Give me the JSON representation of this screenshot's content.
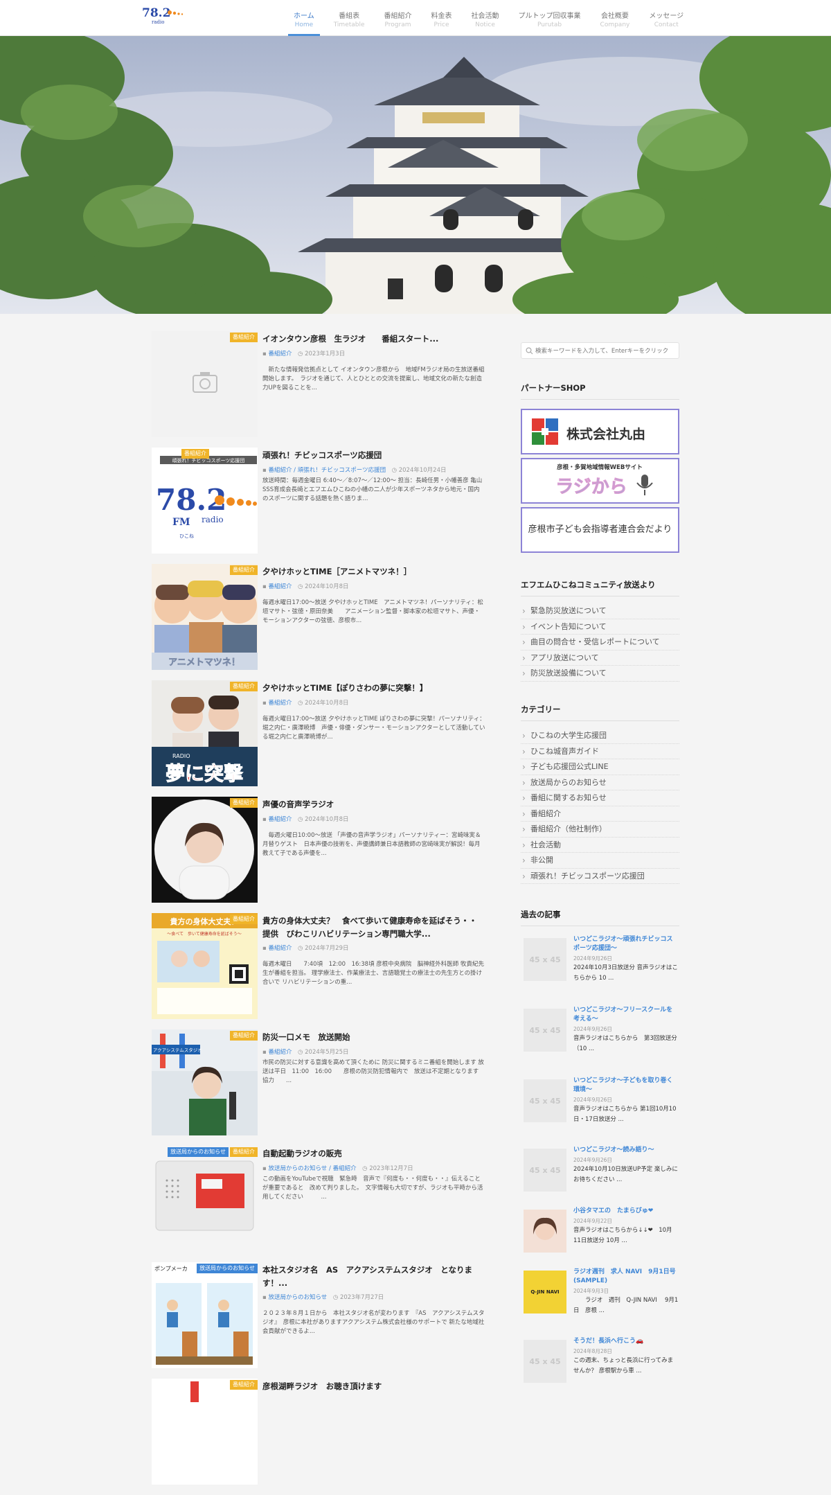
{
  "nav": [
    {
      "jp": "ホーム",
      "en": "Home"
    },
    {
      "jp": "番組表",
      "en": "Timetable"
    },
    {
      "jp": "番組紹介",
      "en": "Program"
    },
    {
      "jp": "料金表",
      "en": "Price"
    },
    {
      "jp": "社会活動",
      "en": "Notice"
    },
    {
      "jp": "プルトップ回収事業",
      "en": "Purutab"
    },
    {
      "jp": "会社概要",
      "en": "Company"
    },
    {
      "jp": "メッセージ",
      "en": "Contact"
    }
  ],
  "logo": {
    "number": "78.2",
    "sub": "radio"
  },
  "posts": [
    {
      "tag": "番組紹介",
      "title": "イオンタウン彦根　生ラジオ　　番組スタート...",
      "cats": "番組紹介",
      "date": "2023年1月3日",
      "excerpt": "　新たな情報発信拠点として イオンタウン彦根から　地域FMラジオ局の生放送番組 開始します。　ラジオを通じて、人とひととの交流を提案し、地域文化の新たな創造力UPを図ることを..."
    },
    {
      "tag": "番組紹介",
      "title": "頑張れ！チビッコスポーツ応援団",
      "cats": "番組紹介 / 頑張れ！チビッコスポーツ応援団",
      "date": "2024年10月24日",
      "excerpt": "放送時間：毎週金曜日 6:40〜／8:07〜／12:00〜 担当：長崎任男・小幡善彦 亀山SSS育成会長崎とエフエムひこねの小幡の二人が少年スポーツネタから地元・国内のスポーツに関する話題を熱く語りま..."
    },
    {
      "tag": "番組紹介",
      "title": "夕やけホッとTIME［アニメトマツネ！］",
      "cats": "番組紹介",
      "date": "2024年10月8日",
      "excerpt": "毎週水曜日17:00〜放送 夕やけホッとTIME　アニメトマツネ！パーソナリティ：松垣マサト・弦徳・原田奈美　　アニメーション監督・脚本家の松垣マサト、声優・モーションアクターの弦徳、彦根市..."
    },
    {
      "tag": "番組紹介",
      "title": "夕やけホッとTIME【ぽりさわの夢に突撃！】",
      "cats": "番組紹介",
      "date": "2024年10月8日",
      "excerpt": "毎週火曜日17:00〜放送 夕やけホッとTIME ぽりさわの夢に突撃！パーソナリティ：堀之内仁・廣澤暁博　声優・俳優・ダンサー・モーションアクターとして活動している堀之内仁と廣澤暁博が..."
    },
    {
      "tag": "番組紹介",
      "title": "声優の音声学ラジオ",
      "cats": "番組紹介",
      "date": "2024年10月8日",
      "excerpt": "　毎週火曜日10:00〜放送 「声優の音声学ラジオ」パーソナリティー：宮崎味実＆月替りゲスト　日本声優の技術を、声優講師兼日本語教師の宮崎味実が解説！毎月教えて子である声優を..."
    },
    {
      "tag": "番組紹介",
      "title": "貴方の身体大丈夫？　食べて歩いて健康寿命を延ばそう・・ 提供　びわこリハビリテーション専門職大学...",
      "cats": "番組紹介",
      "date": "2024年7月29日",
      "excerpt": "毎週木曜日　　7:40頃　12:00　16:38頃 彦根中央病院　脳神経外科医師 牧責紀先生が番組を担当。 理学療法士、作業療法士、言語聴覚士の療法士の先生方との掛け合いで リハビリテーションの重..."
    },
    {
      "tag": "番組紹介",
      "title": "防災一口メモ　放送開始",
      "cats": "番組紹介",
      "date": "2024年5月25日",
      "excerpt": "市民の防災に対する意識を高めて頂くために 防災に関するミニ番組を開始します 放送は平日　11:00　16:00　　彦根の防災防犯情報内で　放送は不定期となります　　協力　　..."
    },
    {
      "tag": "番組紹介",
      "tag2": "放送局からのお知らせ",
      "title": "自動起動ラジオの販売",
      "cats": "放送局からのお知らせ / 番組紹介",
      "date": "2023年12月7日",
      "excerpt": "この動画をYouTubeで視聴　緊急時　音声で『何度も・・何度も・・』伝えることが重要であると　改めて判りました。　文字情報も大切ですが、ラジオも平時から活用してください　　　..."
    },
    {
      "tag": "放送局からのお知らせ",
      "title": "本社スタジオ名　AS　アクアシステムスタジオ　となります！...",
      "cats": "放送局からのお知らせ",
      "date": "2023年7月27日",
      "excerpt": "２０２３年８月１日から　本社スタジオ名が変わります　『AS　アクアシステムスタジオ』　彦根に本社がありますアクアシステム株式会社様のサポートで 新たな地域社会貢献ができるよ..."
    },
    {
      "tag": "番組紹介",
      "title": "彦根湖畔ラジオ　お聴き頂けます",
      "cats": "番組紹介",
      "date": "",
      "excerpt": ""
    }
  ],
  "thumbs": {
    "p2": {
      "big": "78.2",
      "fm": "FM",
      "radio": "radio",
      "hikone": "ひこね",
      "banner": "頑張れ！チビッコスポーツ応援団"
    },
    "p3": {
      "banner": "アニメトマツネ！"
    },
    "p4": {
      "big": "夢に突撃",
      "radio": "RADIO"
    },
    "p6": {
      "title": "貴方の身体大丈夫？",
      "sub": "〜食べて　歩いて健康寿命を延ばそう〜"
    },
    "p7": {
      "sign": "アクアシステムスタジオ"
    },
    "p9": {
      "sign": "ポンプメーカ"
    }
  },
  "sidebar": {
    "search_placeholder": "検索キーワードを入力して、Enterキーをクリック",
    "partner_title": "パートナーSHOP",
    "banners": [
      "株式会社丸由",
      "彦根・多賀地域情報WEBサイト",
      "ラジから",
      "彦根市子ども会指導者連合会だより"
    ],
    "news_title": "エフエムひこねコミュニティ放送より",
    "news": [
      "緊急防災放送について",
      "イベント告知について",
      "曲目の問合せ・受信レポートについて",
      "アプリ放送について",
      "防災放送設備について"
    ],
    "cat_title": "カテゴリー",
    "cats": [
      "ひこねの大学生応援団",
      "ひこね城音声ガイド",
      "子ども応援団公式LINE",
      "放送局からのお知らせ",
      "番組に関するお知らせ",
      "番組紹介",
      "番組紹介（他社制作）",
      "社会活動",
      "非公開",
      "頑張れ！チビッコスポーツ応援団"
    ],
    "past_title": "過去の記事",
    "past": [
      {
        "thumb": "45 x 45",
        "title": "いつどこラジオ〜頑張れチビッコスポーツ応援団〜",
        "date": "2024年9月26日",
        "excerpt": "2024年10月3日放送分 音声ラジオはこちらから 10 ..."
      },
      {
        "thumb": "45 x 45",
        "title": "いつどこラジオ〜フリースクールを考える〜",
        "date": "2024年9月26日",
        "excerpt": "音声ラジオはこちらから　第3回放送分（10 ..."
      },
      {
        "thumb": "45 x 45",
        "title": "いつどこラジオ〜子どもを取り巻く環境〜",
        "date": "2024年9月26日",
        "excerpt": "音声ラジオはこちらから 第1回10月10日・17日放送分 ..."
      },
      {
        "thumb": "45 x 45",
        "title": "いつどこラジオ〜読み語り〜",
        "date": "2024年9月26日",
        "excerpt": "2024年10月10日放送UP予定 楽しみにお待ちください ..."
      },
      {
        "thumb": "",
        "title": "小谷タマエの　たまらびゅ❤",
        "date": "2024年9月22日",
        "excerpt": "音声ラジオはこちらから↓↓❤　10月11日放送分 10月 ..."
      },
      {
        "thumb": "Q-JIN NAVI",
        "title": "ラジオ週刊　求人 NAVI　9月1日号(SAMPLE)",
        "date": "2024年9月3日",
        "excerpt": "　　ラジオ　週刊　Q-JIN NAVI　 9月1日　彦根 ..."
      },
      {
        "thumb": "45 x 45",
        "title": "そうだ！長浜へ行こう🚗",
        "date": "2024年8月28日",
        "excerpt": "この週末、ちょっと長浜に行ってみませんか？ 彦根駅から車 ..."
      }
    ]
  },
  "colors": {
    "accent": "#3e86d6",
    "tag": "#f0b429",
    "banner_border": "#8c83d6"
  }
}
